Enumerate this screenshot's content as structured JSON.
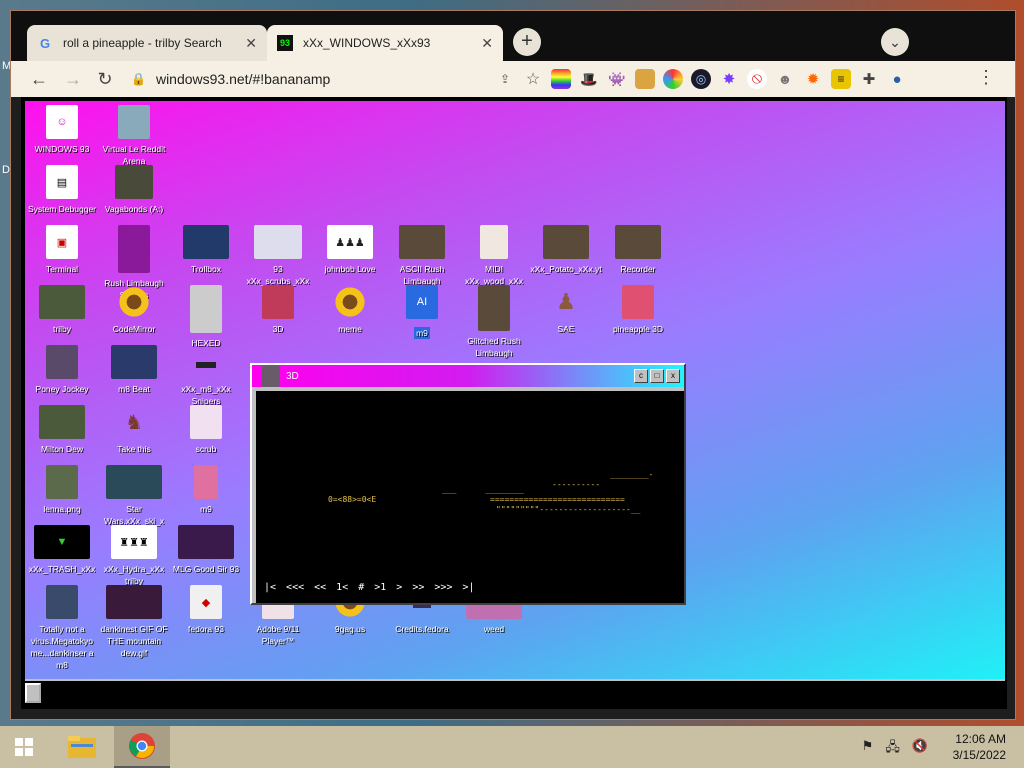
{
  "browser": {
    "tabs": [
      {
        "title": "roll a pineapple - trilby Search",
        "favicon": "google-g-icon",
        "active": false
      },
      {
        "title": "xXx_WINDOWS_xXx93",
        "favicon": "windows93-icon",
        "active": true
      }
    ],
    "new_tab_label": "+",
    "tab_search_label": "⌄",
    "url": "windows93.net/#!bananamp",
    "menu_label": "⋮"
  },
  "desktop93": {
    "icons": [
      {
        "label": "WINDOWS 93"
      },
      {
        "label": "Virtual Le Reddit Arena"
      },
      {
        "label": "System Debugger"
      },
      {
        "label": "Vagabonds (A:)"
      },
      {
        "label": "Terminal"
      },
      {
        "label": "Rush Limbaugh Snipers"
      },
      {
        "label": "Trollbox"
      },
      {
        "label": "93 xXx_scrubs_xXx"
      },
      {
        "label": "johnbob Love"
      },
      {
        "label": "ASCII Rush Limbaugh"
      },
      {
        "label": "MIDI xXx_wood_xXx"
      },
      {
        "label": "xXx_Potato_xXx.yt"
      },
      {
        "label": "Recorder"
      },
      {
        "label": "trilby"
      },
      {
        "label": "CodeMirror"
      },
      {
        "label": "HEXED"
      },
      {
        "label": "3D"
      },
      {
        "label": "meme"
      },
      {
        "label": "m9"
      },
      {
        "label": "Glitched Rush Limbaugh"
      },
      {
        "label": "SAE"
      },
      {
        "label": "pineapple 3D"
      },
      {
        "label": "Poney Jockey"
      },
      {
        "label": "m8 Beat"
      },
      {
        "label": "xXx_m8_xXx Snipers"
      },
      {
        "label": "Milton Dew"
      },
      {
        "label": "Take this"
      },
      {
        "label": "scrub"
      },
      {
        "label": "lenna.png"
      },
      {
        "label": "Star Wars.xXx_ski_x"
      },
      {
        "label": "m9"
      },
      {
        "label": "xXx_TRASH_xXx"
      },
      {
        "label": "xXx_Hydra_xXx trilby"
      },
      {
        "label": "MLG Good Sir 93"
      },
      {
        "label": "Totally not a virus.Megatokyo me...dankinser a m8"
      },
      {
        "label": "dankinest GIF OF THE mountain dew.gif"
      },
      {
        "label": "fedora 93"
      },
      {
        "label": "Adobe 9/11 Player™"
      },
      {
        "label": "9gag.us"
      },
      {
        "label": "Credits.fedora"
      },
      {
        "label": "weed"
      }
    ]
  },
  "window3d": {
    "title": "3D",
    "buttons": [
      "c",
      "□",
      "x"
    ],
    "ascii_lines": [
      "0=<88>=0<E",
      "________-",
      "----------",
      "___      ________",
      "============================",
      "\"\"\"\"\"\"\"\"\"-------------------__"
    ],
    "controls": [
      "|<",
      "<<<",
      "<<",
      "1<",
      "#",
      ">1",
      ">",
      ">>",
      ">>>",
      ">|"
    ]
  },
  "taskbar": {
    "time": "12:06 AM",
    "date": "3/15/2022"
  }
}
